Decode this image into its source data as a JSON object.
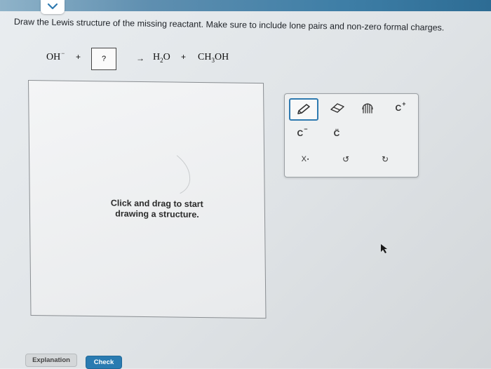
{
  "prompt": "Draw the Lewis structure of the missing reactant. Make sure to include lone pairs and non-zero formal charges.",
  "equation": {
    "reactant1": "OH",
    "reactant1_charge": "−",
    "plus1": "+",
    "missing_placeholder": "?",
    "arrow": "→",
    "product1_main": "H",
    "product1_sub": "2",
    "product1_end": "O",
    "plus2": "+",
    "product2_main": "CH",
    "product2_sub": "3",
    "product2_end": "OH"
  },
  "canvas": {
    "hint_line1": "Click and drag to start",
    "hint_line2": "drawing a structure."
  },
  "toolbar": {
    "charge_minus_label": "C",
    "charge_minus_sup": "−",
    "lone_pair_label": "C̈",
    "charge_plus_label": "C",
    "charge_plus_sup": "+",
    "clear_label": "X",
    "undo_label": "↺",
    "redo_label": "↻"
  },
  "buttons": {
    "explanation": "Explanation",
    "check": "Check"
  },
  "colors": {
    "accent": "#2a7bb1",
    "top_strip": "#3e7ea6"
  }
}
